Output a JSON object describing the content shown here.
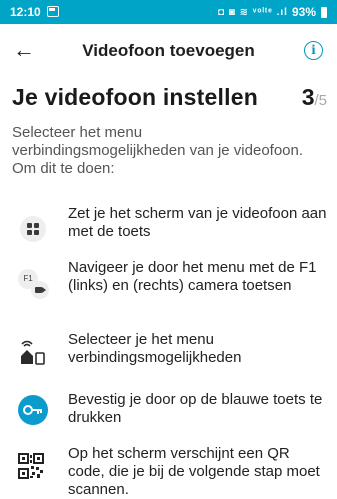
{
  "status_bar": {
    "time": "12:10",
    "glyphs": "◘ ◙ ≋ ᵛᵒˡᵗᵉ .ıl",
    "battery": "93%",
    "accent_color": "#00a4c7"
  },
  "header": {
    "back_icon": "←",
    "title": "Videofoon toevoegen",
    "info_icon": "i"
  },
  "page": {
    "title": "Je videofoon instellen",
    "step_current": "3",
    "step_total": "/5",
    "intro": "Selecteer het menu verbindingsmogelijkheden van je videofoon. Om dit te doen:"
  },
  "steps": [
    {
      "icon": "grid-icon",
      "text": "Zet je het scherm van je videofoon aan met de toets"
    },
    {
      "icon": "f1-camera-icon",
      "f1_label": "F1",
      "text": "Navigeer je door het menu met de F1 (links) en (rechts) camera toetsen"
    },
    {
      "icon": "connection-icon",
      "text": "Selecteer je het menu verbindingsmogelijkheden"
    },
    {
      "icon": "key-icon",
      "text": "Bevestig je door op de blauwe toets te drukken"
    },
    {
      "icon": "qr-code-icon",
      "text": "Op het scherm verschijnt een QR code, die je bij de volgende stap moet scannen."
    }
  ]
}
